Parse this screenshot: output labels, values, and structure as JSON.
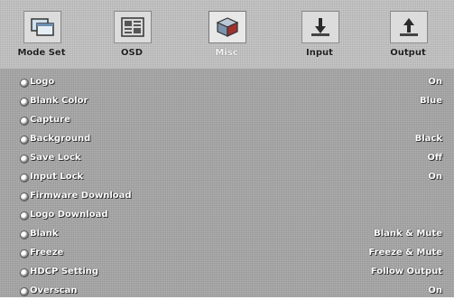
{
  "tabs": [
    {
      "label": "Mode Set",
      "icon": "window-icon"
    },
    {
      "label": "OSD",
      "icon": "osd-grid-icon"
    },
    {
      "label": "Misc",
      "icon": "cube-icon"
    },
    {
      "label": "Input",
      "icon": "input-arrow-icon"
    },
    {
      "label": "Output",
      "icon": "output-arrow-icon"
    }
  ],
  "active_tab": "Misc",
  "menu": [
    {
      "label": "Logo",
      "value": "On"
    },
    {
      "label": "Blank Color",
      "value": "Blue"
    },
    {
      "label": "Capture",
      "value": ""
    },
    {
      "label": "Background",
      "value": "Black"
    },
    {
      "label": "Save Lock",
      "value": "Off"
    },
    {
      "label": "Input Lock",
      "value": "On"
    },
    {
      "label": "Firmware Download",
      "value": ""
    },
    {
      "label": "Logo Download",
      "value": ""
    },
    {
      "label": "Blank",
      "value": "Blank & Mute"
    },
    {
      "label": "Freeze",
      "value": "Freeze & Mute"
    },
    {
      "label": "HDCP Setting",
      "value": "Follow Output"
    },
    {
      "label": "Overscan",
      "value": "On"
    }
  ],
  "colors": {
    "background": "#9a9a9a",
    "topbar": "#c9c9c9",
    "text": "#ffffff"
  }
}
